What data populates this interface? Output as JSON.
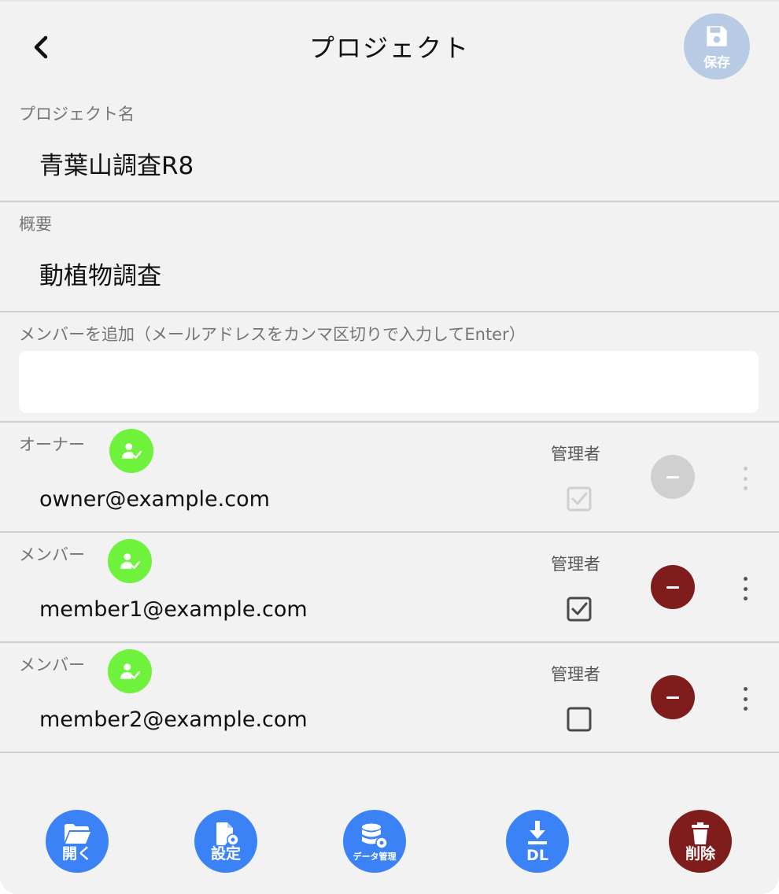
{
  "header": {
    "title": "プロジェクト",
    "back_icon": "chevron-left-icon",
    "save_label": "保存"
  },
  "project_name": {
    "label": "プロジェクト名",
    "value": "青葉山調査R8"
  },
  "overview": {
    "label": "概要",
    "value": "動植物調査"
  },
  "add_member": {
    "label": "メンバーを追加（メールアドレスをカンマ区切りで入力してEnter）",
    "value": "",
    "placeholder": ""
  },
  "members": [
    {
      "role": "オーナー",
      "email": "owner@example.com",
      "admin_label": "管理者",
      "is_admin": true,
      "admin_disabled": true,
      "remove_enabled": false
    },
    {
      "role": "メンバー",
      "email": "member1@example.com",
      "admin_label": "管理者",
      "is_admin": true,
      "admin_disabled": false,
      "remove_enabled": true
    },
    {
      "role": "メンバー",
      "email": "member2@example.com",
      "admin_label": "管理者",
      "is_admin": false,
      "admin_disabled": false,
      "remove_enabled": true
    }
  ],
  "toolbar": {
    "open_label": "開く",
    "settings_label": "設定",
    "data_label": "データ管理",
    "download_label": "DL",
    "delete_label": "削除"
  },
  "colors": {
    "background": "#f2f2f2",
    "primary": "#3b82f6",
    "danger": "#7f1d1d",
    "save_disabled": "#b8cbe4",
    "badge": "#6ef23c",
    "disabled": "#d0d0d0"
  }
}
